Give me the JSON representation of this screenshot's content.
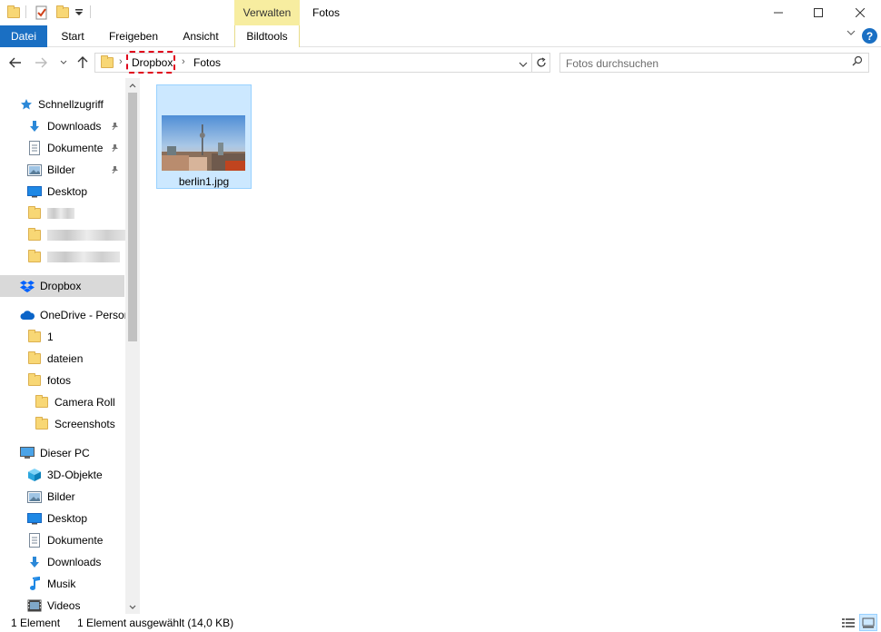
{
  "titlebar": {
    "context_tab": "Verwalten",
    "window_title": "Fotos",
    "minimize_icon": "minimize-icon",
    "maximize_icon": "maximize-icon",
    "close_icon": "close-icon"
  },
  "ribbon": {
    "tabs": [
      "Datei",
      "Start",
      "Freigeben",
      "Ansicht",
      "Bildtools"
    ],
    "accent": "#1a6fc3",
    "context_color": "#f7eda0"
  },
  "address": {
    "segments": [
      "Dropbox",
      "Fotos"
    ],
    "search_placeholder": "Fotos durchsuchen"
  },
  "nav": {
    "quick_access": "Schnellzugriff",
    "qa_items": [
      "Downloads",
      "Dokumente",
      "Bilder",
      "Desktop"
    ],
    "dropbox": "Dropbox",
    "onedrive": "OneDrive - Persor",
    "onedrive_items": [
      "1",
      "dateien",
      "fotos"
    ],
    "fotos_children": [
      "Camera Roll",
      "Screenshots"
    ],
    "this_pc": "Dieser PC",
    "pc_items": [
      "3D-Objekte",
      "Bilder",
      "Desktop",
      "Dokumente",
      "Downloads",
      "Musik",
      "Videos"
    ]
  },
  "content": {
    "files": [
      {
        "name": "berlin1.jpg"
      }
    ]
  },
  "status": {
    "count": "1 Element",
    "selection": "1 Element ausgewählt (14,0 KB)"
  }
}
